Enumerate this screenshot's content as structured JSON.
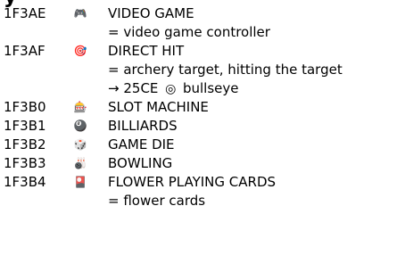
{
  "heading_fragment": "y",
  "entries": [
    {
      "code": "1F3AE",
      "glyph_icon": "video-game-controller-icon",
      "glyph_char": "🎮",
      "name": "VIDEO GAME",
      "notes": [
        "= video game controller"
      ]
    },
    {
      "code": "1F3AF",
      "glyph_icon": "direct-hit-target-icon",
      "glyph_char": "🎯",
      "name": "DIRECT HIT",
      "notes": [
        "= archery target, hitting the target"
      ],
      "xref": {
        "arrow": "→",
        "code": "25CE",
        "glyph_char": "◎",
        "name": "bullseye"
      }
    },
    {
      "code": "1F3B0",
      "glyph_icon": "slot-machine-icon",
      "glyph_char": "🎰",
      "name": "SLOT MACHINE"
    },
    {
      "code": "1F3B1",
      "glyph_icon": "billiards-icon",
      "glyph_char": "🎱",
      "name": "BILLIARDS"
    },
    {
      "code": "1F3B2",
      "glyph_icon": "game-die-icon",
      "glyph_char": "🎲",
      "name": "GAME DIE"
    },
    {
      "code": "1F3B3",
      "glyph_icon": "bowling-icon",
      "glyph_char": "🎳",
      "name": "BOWLING"
    },
    {
      "code": "1F3B4",
      "glyph_icon": "flower-playing-cards-icon",
      "glyph_char": "🎴",
      "name": "FLOWER PLAYING CARDS",
      "notes": [
        "= flower cards"
      ]
    }
  ]
}
